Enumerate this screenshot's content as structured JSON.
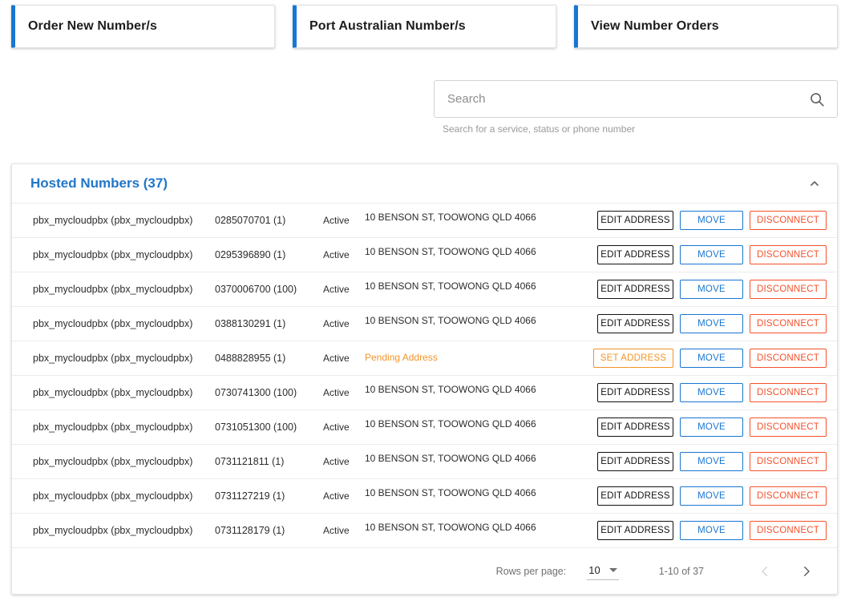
{
  "action_cards": [
    {
      "label": "Order New Number/s",
      "accent": "#1976d2"
    },
    {
      "label": "Port Australian Number/s",
      "accent": "#1976d2"
    },
    {
      "label": "View Number Orders",
      "accent": "#1976d2"
    }
  ],
  "search": {
    "value": "",
    "placeholder": "Search",
    "hint": "Search for a service, status or phone number",
    "icon": "search-icon"
  },
  "panel": {
    "title": "Hosted Numbers (37)",
    "title_color": "#2176c7",
    "collapse_icon": "chevron-up-icon",
    "expanded": true
  },
  "table": {
    "rows": [
      {
        "service": "pbx_mycloudpbx (pbx_mycloudpbx)",
        "number": "0285070701 (1)",
        "status": "Active",
        "address": "10 BENSON ST, TOOWONG QLD 4066",
        "address_pending": false,
        "address_button": "EDIT ADDRESS",
        "move_button": "MOVE",
        "disconnect_button": "DISCONNECT"
      },
      {
        "service": "pbx_mycloudpbx (pbx_mycloudpbx)",
        "number": "0295396890 (1)",
        "status": "Active",
        "address": "10 BENSON ST, TOOWONG QLD 4066",
        "address_pending": false,
        "address_button": "EDIT ADDRESS",
        "move_button": "MOVE",
        "disconnect_button": "DISCONNECT"
      },
      {
        "service": "pbx_mycloudpbx (pbx_mycloudpbx)",
        "number": "0370006700 (100)",
        "status": "Active",
        "address": "10 BENSON ST, TOOWONG QLD 4066",
        "address_pending": false,
        "address_button": "EDIT ADDRESS",
        "move_button": "MOVE",
        "disconnect_button": "DISCONNECT"
      },
      {
        "service": "pbx_mycloudpbx (pbx_mycloudpbx)",
        "number": "0388130291 (1)",
        "status": "Active",
        "address": "10 BENSON ST, TOOWONG QLD 4066",
        "address_pending": false,
        "address_button": "EDIT ADDRESS",
        "move_button": "MOVE",
        "disconnect_button": "DISCONNECT"
      },
      {
        "service": "pbx_mycloudpbx (pbx_mycloudpbx)",
        "number": "0488828955 (1)",
        "status": "Active",
        "address": "Pending Address",
        "address_pending": true,
        "address_button": "SET ADDRESS",
        "move_button": "MOVE",
        "disconnect_button": "DISCONNECT"
      },
      {
        "service": "pbx_mycloudpbx (pbx_mycloudpbx)",
        "number": "0730741300 (100)",
        "status": "Active",
        "address": "10 BENSON ST, TOOWONG QLD 4066",
        "address_pending": false,
        "address_button": "EDIT ADDRESS",
        "move_button": "MOVE",
        "disconnect_button": "DISCONNECT"
      },
      {
        "service": "pbx_mycloudpbx (pbx_mycloudpbx)",
        "number": "0731051300 (100)",
        "status": "Active",
        "address": "10 BENSON ST, TOOWONG QLD 4066",
        "address_pending": false,
        "address_button": "EDIT ADDRESS",
        "move_button": "MOVE",
        "disconnect_button": "DISCONNECT"
      },
      {
        "service": "pbx_mycloudpbx (pbx_mycloudpbx)",
        "number": "0731121811 (1)",
        "status": "Active",
        "address": "10 BENSON ST, TOOWONG QLD 4066",
        "address_pending": false,
        "address_button": "EDIT ADDRESS",
        "move_button": "MOVE",
        "disconnect_button": "DISCONNECT"
      },
      {
        "service": "pbx_mycloudpbx (pbx_mycloudpbx)",
        "number": "0731127219 (1)",
        "status": "Active",
        "address": "10 BENSON ST, TOOWONG QLD 4066",
        "address_pending": false,
        "address_button": "EDIT ADDRESS",
        "move_button": "MOVE",
        "disconnect_button": "DISCONNECT"
      },
      {
        "service": "pbx_mycloudpbx (pbx_mycloudpbx)",
        "number": "0731128179 (1)",
        "status": "Active",
        "address": "10 BENSON ST, TOOWONG QLD 4066",
        "address_pending": false,
        "address_button": "EDIT ADDRESS",
        "move_button": "MOVE",
        "disconnect_button": "DISCONNECT"
      }
    ]
  },
  "pagination": {
    "rows_per_page_label": "Rows per page:",
    "rows_per_page_value": "10",
    "range_label": "1-10 of 37",
    "prev_icon": "chevron-left-icon",
    "next_icon": "chevron-right-icon",
    "prev_enabled": false,
    "next_enabled": true
  },
  "colors": {
    "accent_blue": "#1976d2",
    "title_blue": "#2176c7",
    "pending_orange": "#f39428",
    "danger_red": "#f4512c",
    "dark": "#111111"
  }
}
